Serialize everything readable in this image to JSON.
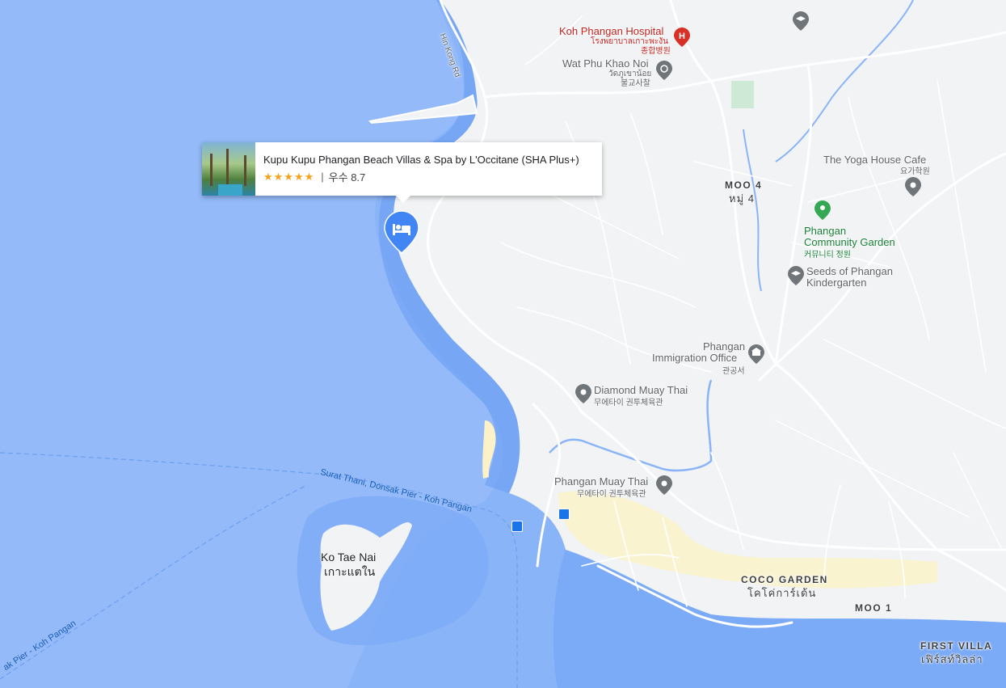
{
  "hotel_card": {
    "title": "Kupu Kupu Phangan Beach Villas & Spa by L'Occitane (SHA Plus+)",
    "stars": "★★★★★",
    "separator": "|",
    "rating": "우수 8.7"
  },
  "labels": {
    "hin_kong_rd": "Hin Kong Rd",
    "hospital_en": "Koh Phangan Hospital",
    "hospital_th": "โรงพยาบาลเกาะพะงัน",
    "hospital_ko": "종합병원",
    "wat_en": "Wat Phu Khao Noi",
    "wat_th": "วัดภูเขาน้อย",
    "wat_ko": "불교사찰",
    "yoga_en": "The Yoga House Cafe",
    "yoga_ko": "요가학원",
    "moo4_en": "MOO 4",
    "moo4_th": "หมู่ 4",
    "garden_en_1": "Phangan",
    "garden_en_2": "Community Garden",
    "garden_ko": "커뮤니티 정원",
    "seeds_1": "Seeds of Phangan",
    "seeds_2": "Kindergarten",
    "immig_1": "Phangan",
    "immig_2": "Immigration Office",
    "immig_ko": "관공서",
    "diamond_en": "Diamond Muay Thai",
    "diamond_ko": "무에타이 권투체육관",
    "phangan_muay_en": "Phangan Muay Thai",
    "phangan_muay_ko": "무에타이 권투체육관",
    "ferry_route": "Surat Thani, Donsak Pier - Koh Pangan",
    "ferry_route_2": "ak Pier - Koh Pangan",
    "island_en": "Ko Tae Nai",
    "island_th": "เกาะแตใน",
    "coco_en": "COCO GARDEN",
    "coco_th": "โคโค่การ์เด้น",
    "moo1": "MOO 1",
    "first_villa_en": "FIRST VILLA",
    "first_villa_th": "เฟิร์สท์วิลล่า"
  },
  "colors": {
    "water": "#7baaf7",
    "water_deep": "#8ab4f8",
    "land": "#f1f3f4",
    "town": "#fdf2c7",
    "park": "#ceead6",
    "road": "#ffffff",
    "poi_gray": "#70757a",
    "hospital_red": "#d93025",
    "hotel_blue": "#4285f4"
  }
}
